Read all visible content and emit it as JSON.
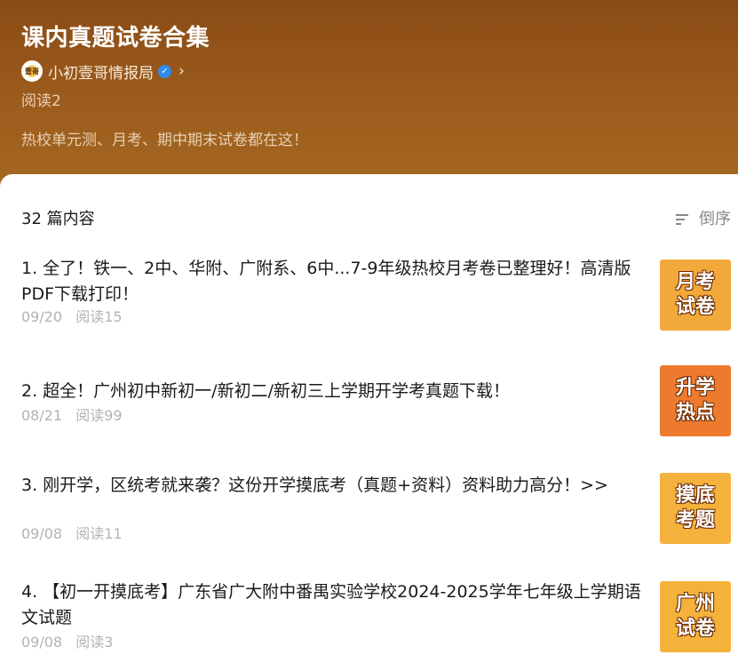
{
  "header": {
    "title": "课内真题试卷合集",
    "author": "小初壹哥情报局",
    "avatar_text": "壹哥",
    "verified_mark": "✓",
    "chevron": "›",
    "reads": "阅读2",
    "description": "热校单元测、月考、期中期末试卷都在这！",
    "background_color": "#9a5a1c"
  },
  "list": {
    "count_label": "32 篇内容",
    "sort_label": "倒序",
    "sort_icon": "sort-lines-icon",
    "items": [
      {
        "title": "1. 全了！铁一、2中、华附、广附系、6中...7-9年级热校月考卷已整理好！高清版PDF下载打印！",
        "date": "09/20",
        "reads": "阅读15",
        "thumb_line1": "月考",
        "thumb_line2": "试卷",
        "thumb_color": "#f2a93b"
      },
      {
        "title": "2. 超全！广州初中新初一/新初二/新初三上学期开学考真题下载！",
        "date": "08/21",
        "reads": "阅读99",
        "thumb_line1": "升学",
        "thumb_line2": "热点",
        "thumb_color": "#ee7a2e"
      },
      {
        "title": "3. 刚开学，区统考就来袭？这份开学摸底考（真题+资料）资料助力高分！>>",
        "date": "09/08",
        "reads": "阅读11",
        "thumb_line1": "摸底",
        "thumb_line2": "考题",
        "thumb_color": "#f4b13c"
      },
      {
        "title": "4. 【初一开摸底考】广东省广大附中番禺实验学校2024-2025学年七年级上学期语文试题",
        "date": "09/08",
        "reads": "阅读3",
        "thumb_line1": "广州",
        "thumb_line2": "试卷",
        "thumb_color": "#f5b23a"
      }
    ]
  }
}
